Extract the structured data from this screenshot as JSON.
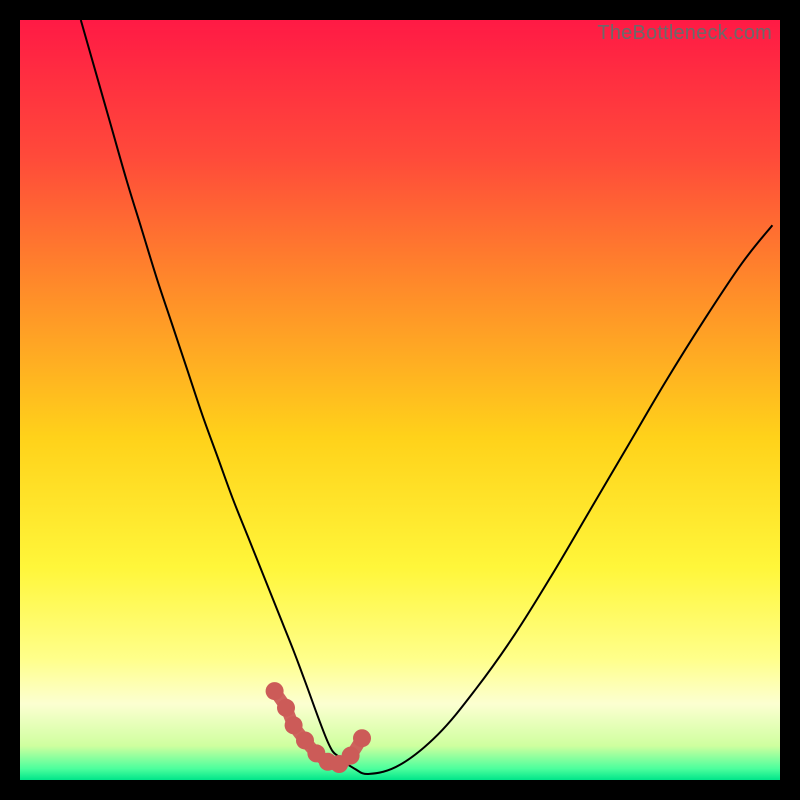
{
  "watermark": "TheBottleneck.com",
  "chart_data": {
    "type": "line",
    "title": "",
    "xlabel": "",
    "ylabel": "",
    "xlim": [
      0,
      100
    ],
    "ylim": [
      0,
      100
    ],
    "grid": false,
    "legend": false,
    "background_gradient": {
      "stops": [
        {
          "offset": 0.0,
          "color": "#ff1a45"
        },
        {
          "offset": 0.18,
          "color": "#ff4a3a"
        },
        {
          "offset": 0.35,
          "color": "#ff8a2a"
        },
        {
          "offset": 0.55,
          "color": "#ffd21a"
        },
        {
          "offset": 0.72,
          "color": "#fff63a"
        },
        {
          "offset": 0.84,
          "color": "#ffff8a"
        },
        {
          "offset": 0.9,
          "color": "#fcffd1"
        },
        {
          "offset": 0.955,
          "color": "#cfff9f"
        },
        {
          "offset": 0.985,
          "color": "#4dff9d"
        },
        {
          "offset": 1.0,
          "color": "#00e58a"
        }
      ]
    },
    "series": [
      {
        "name": "bottleneck-curve",
        "stroke": "#000000",
        "type": "line",
        "x": [
          8,
          10,
          12,
          14,
          16,
          18,
          20,
          22,
          24,
          26,
          28,
          30,
          32,
          34,
          36,
          37.5,
          40.5,
          42,
          44,
          46,
          50,
          55,
          60,
          65,
          70,
          75,
          80,
          85,
          90,
          95,
          99
        ],
        "y": [
          100,
          93,
          86,
          79,
          72.5,
          66,
          60,
          54,
          48,
          42.5,
          37,
          32,
          27,
          22,
          17,
          13,
          5,
          3,
          1.5,
          0.8,
          2,
          6,
          12,
          19,
          27,
          35.5,
          44,
          52.5,
          60.5,
          68,
          73
        ]
      },
      {
        "name": "highlight-dots",
        "stroke": "#cc5b58",
        "type": "scatter",
        "x": [
          33.5,
          35,
          36,
          37.5,
          39,
          40.5,
          42,
          43.5,
          45
        ],
        "y": [
          11.7,
          9.5,
          7.2,
          5.2,
          3.5,
          2.4,
          2.1,
          3.2,
          5.5
        ]
      }
    ]
  }
}
